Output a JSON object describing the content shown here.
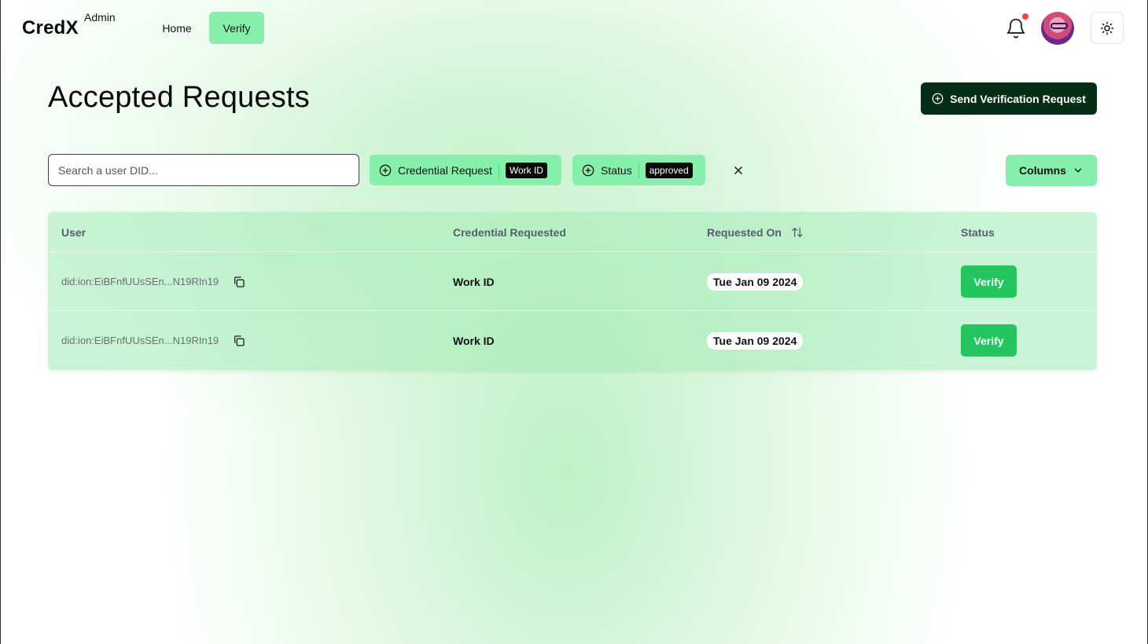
{
  "nav": {
    "brand": "CredX",
    "brand_sub": "Admin",
    "links": [
      {
        "label": "Home"
      },
      {
        "label": "Verify"
      }
    ],
    "notification_badge_color": "#ef4444",
    "icons": [
      "bell-icon",
      "avatar",
      "sun-icon"
    ]
  },
  "page": {
    "title": "Accepted Requests",
    "send_button_label": "Send Verification Request"
  },
  "filters": {
    "search_placeholder": "Search a user DID...",
    "search_value": "",
    "credential_chip": {
      "label": "Credential Request",
      "value": "Work ID"
    },
    "status_chip": {
      "label": "Status",
      "value": "approved"
    },
    "columns_label": "Columns"
  },
  "table": {
    "columns": [
      "User",
      "Credential Requested",
      "Requested On",
      "Status"
    ],
    "rows": [
      {
        "user": "did:ion:EiBFnfUUsSEn...N19RIn19",
        "credential": "Work ID",
        "date": "Tue Jan 09 2024",
        "action": "Verify"
      },
      {
        "user": "did:ion:EiBFnfUUsSEn...N19RIn19",
        "credential": "Work ID",
        "date": "Tue Jan 09 2024",
        "action": "Verify"
      }
    ]
  },
  "colors": {
    "accent": "#86efac",
    "primary_dark": "#052e16",
    "verify_green": "#22c55e"
  }
}
